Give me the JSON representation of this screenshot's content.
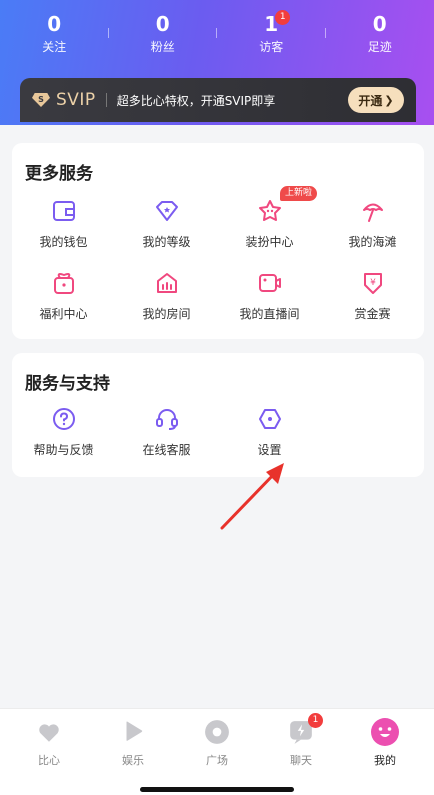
{
  "stats": [
    {
      "value": "0",
      "label": "关注"
    },
    {
      "value": "0",
      "label": "粉丝"
    },
    {
      "value": "1",
      "label": "访客",
      "badge": "1"
    },
    {
      "value": "0",
      "label": "足迹"
    }
  ],
  "svip": {
    "badge_letter": "S",
    "title": "SVIP",
    "text": "超多比心特权，开通SVIP即享",
    "button": "开通",
    "button_chevron": "❯"
  },
  "more_services": {
    "title": "更多服务",
    "items": [
      {
        "label": "我的钱包",
        "icon": "wallet-icon"
      },
      {
        "label": "我的等级",
        "icon": "level-icon"
      },
      {
        "label": "装扮中心",
        "icon": "dressup-icon",
        "tag": "上新啦"
      },
      {
        "label": "我的海滩",
        "icon": "beach-icon"
      },
      {
        "label": "福利中心",
        "icon": "gift-icon"
      },
      {
        "label": "我的房间",
        "icon": "room-icon"
      },
      {
        "label": "我的直播间",
        "icon": "live-icon"
      },
      {
        "label": "赏金赛",
        "icon": "bounty-icon"
      }
    ]
  },
  "support": {
    "title": "服务与支持",
    "items": [
      {
        "label": "帮助与反馈",
        "icon": "help-icon"
      },
      {
        "label": "在线客服",
        "icon": "headset-icon"
      },
      {
        "label": "设置",
        "icon": "settings-icon"
      }
    ]
  },
  "tabbar": [
    {
      "label": "比心",
      "icon": "heart-icon"
    },
    {
      "label": "娱乐",
      "icon": "play-icon"
    },
    {
      "label": "广场",
      "icon": "square-icon"
    },
    {
      "label": "聊天",
      "icon": "chat-icon",
      "badge": "1"
    },
    {
      "label": "我的",
      "icon": "profile-icon",
      "active": true
    }
  ],
  "colors": {
    "accent_purple": "#7b5cf0",
    "accent_pink": "#f0487f",
    "badge_red": "#f23d3d",
    "arrow_red": "#e8322b"
  }
}
